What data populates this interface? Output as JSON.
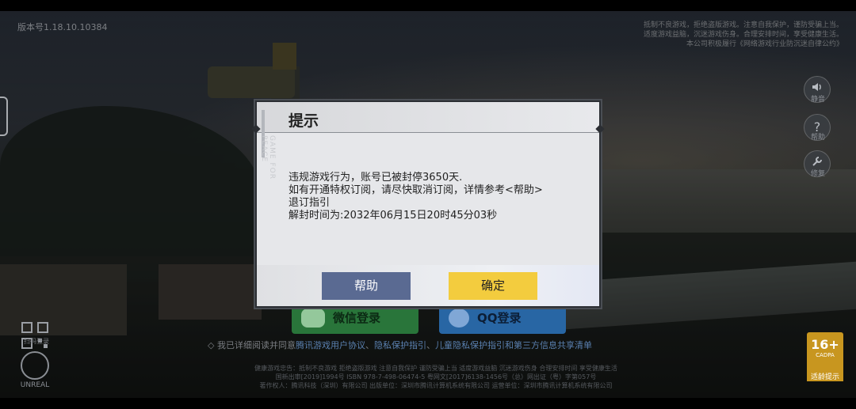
{
  "version_text": "版本号1.18.10.10384",
  "notice_text": "抵制不良游戏，拒绝盗版游戏。注意自我保护，谨防受骗上当。适度游戏益脑，沉迷游戏伤身。合理安排时间，享受健康生活。本公司积极履行《网络游戏行业防沉迷自律公约》",
  "side": {
    "sound_label": "静音",
    "help_label": "帮助",
    "settings_label": "修复"
  },
  "login": {
    "wechat_label": "微信登录",
    "qq_label": "QQ登录"
  },
  "agreement": {
    "prefix": "我已详细阅读并同意",
    "link1": "腾讯游戏用户协议",
    "sep1": "、",
    "link2": "隐私保护指引",
    "sep2": "、",
    "link3": "儿童隐私保护指引和第三方信息共享清单"
  },
  "footer": {
    "line1": "健康游戏忠告：抵制不良游戏 拒绝盗版游戏 注意自我保护 谨防受骗上当 适度游戏益脑 沉迷游戏伤身 合理安排时间 享受健康生活",
    "line2": "国新出审[2019]1994号  ISBN 978-7-498-06474-5  粤网文[2017]6138-1456号（总）网出证（粤）字第057号",
    "line3": "著作权人：腾讯科技（深圳）有限公司  出版单位：深圳市腾讯计算机系统有限公司  运营单位：深圳市腾讯计算机系统有限公司"
  },
  "qr_label": "扫码登录",
  "engine_label": "UNREAL",
  "age_rating": {
    "num": "16+",
    "cadpa": "CADPA",
    "label": "适龄提示"
  },
  "dialog": {
    "title": "提示",
    "watermark": "GAME FOR PEACE",
    "lines": [
      "违规游戏行为，账号已被封停3650天.",
      "如有开通特权订阅，请尽快取消订阅，详情参考<帮助>",
      "退订指引",
      "解封时间为:2032年06月15日20时45分03秒"
    ],
    "help_button": "帮助",
    "ok_button": "确定"
  },
  "colors": {
    "help_button": "#5a6a92",
    "ok_button": "#f3cc3e",
    "dialog_bg": "#e6e7ea"
  }
}
